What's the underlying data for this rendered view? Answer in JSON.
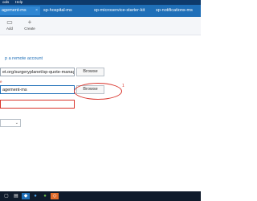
{
  "menu": {
    "items": [
      "ools",
      "Help"
    ]
  },
  "tabs": [
    {
      "label": "agement-ms"
    },
    {
      "label": "sp-hospital-ms"
    },
    {
      "label": "sp-microservice-starter-kit"
    },
    {
      "label": "sp-notifications-ms"
    }
  ],
  "toolbar": {
    "add_label": "Add",
    "create_label": "Create"
  },
  "form": {
    "remote_link": "p a remote account",
    "small_label": "e",
    "repo_path": "et.org/surgeryplanet/sp-quote-manag",
    "name_value": "agement-ms",
    "error_value": "",
    "browse_label": "Browse",
    "browse2_label": "Browse"
  },
  "annotation": {
    "number": "1"
  },
  "colors": {
    "menubar": "#0e3a6b",
    "tabbar": "#1f6fb8",
    "error": "#d9342b",
    "link": "#1f6fb8"
  }
}
